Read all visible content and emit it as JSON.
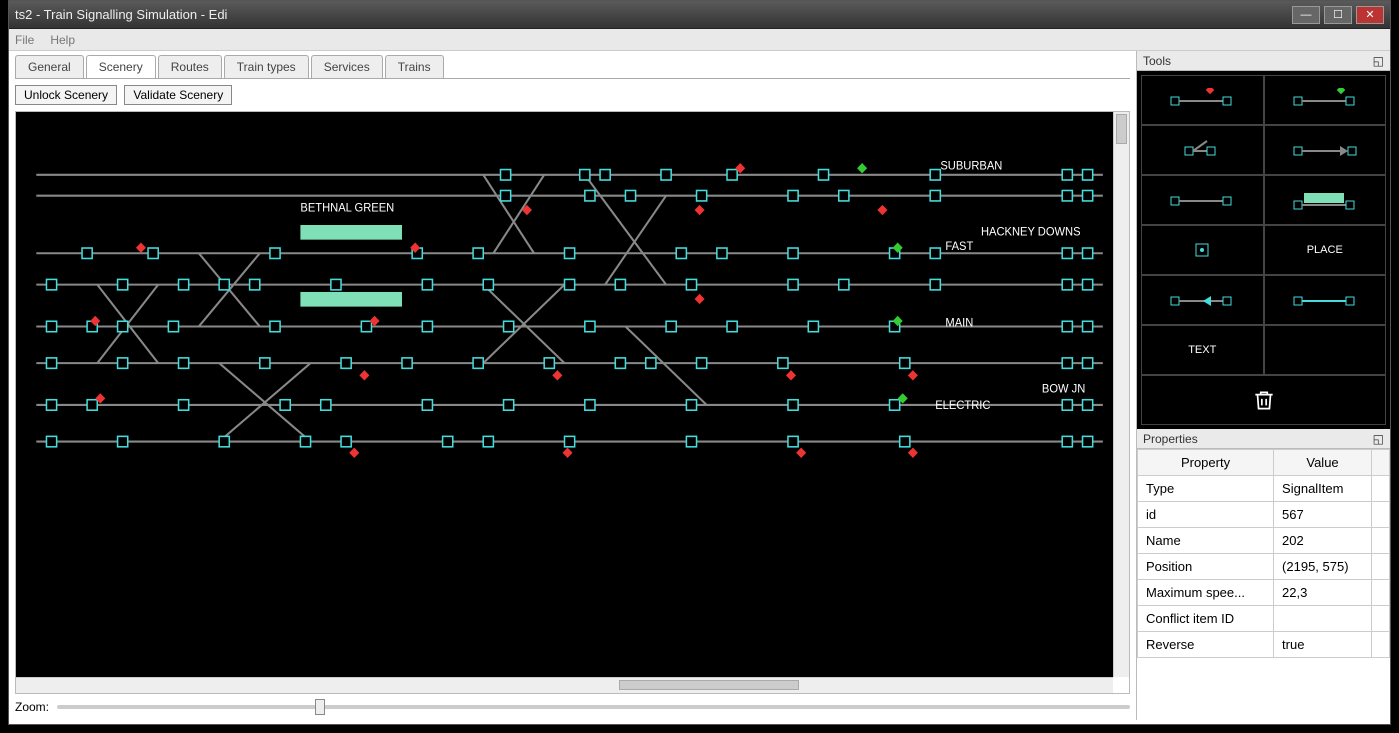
{
  "window": {
    "title": "ts2 - Train Signalling Simulation - Edi"
  },
  "menu": {
    "file": "File",
    "help": "Help"
  },
  "tabs": [
    {
      "label": "General"
    },
    {
      "label": "Scenery",
      "active": true
    },
    {
      "label": "Routes"
    },
    {
      "label": "Train types"
    },
    {
      "label": "Services"
    },
    {
      "label": "Trains"
    }
  ],
  "toolbar": {
    "unlock": "Unlock Scenery",
    "validate": "Validate Scenery"
  },
  "labels": {
    "bethnal": "BETHNAL GREEN",
    "suburban": "SUBURBAN",
    "hackney": "HACKNEY DOWNS",
    "fast": "FAST",
    "main": "MAIN",
    "bowjn": "BOW JN",
    "electric": "ELECTRIC"
  },
  "zoom": {
    "label": "Zoom:"
  },
  "tools": {
    "title": "Tools",
    "place": "PLACE",
    "text": "TEXT"
  },
  "properties": {
    "title": "Properties",
    "header_prop": "Property",
    "header_val": "Value",
    "rows": [
      {
        "prop": "Type",
        "val": "SignalItem"
      },
      {
        "prop": "id",
        "val": "567"
      },
      {
        "prop": "Name",
        "val": "202"
      },
      {
        "prop": "Position",
        "val": "(2195, 575)"
      },
      {
        "prop": "Maximum spee...",
        "val": "22,3"
      },
      {
        "prop": "Conflict item ID",
        "val": ""
      },
      {
        "prop": "Reverse",
        "val": "true"
      }
    ]
  }
}
